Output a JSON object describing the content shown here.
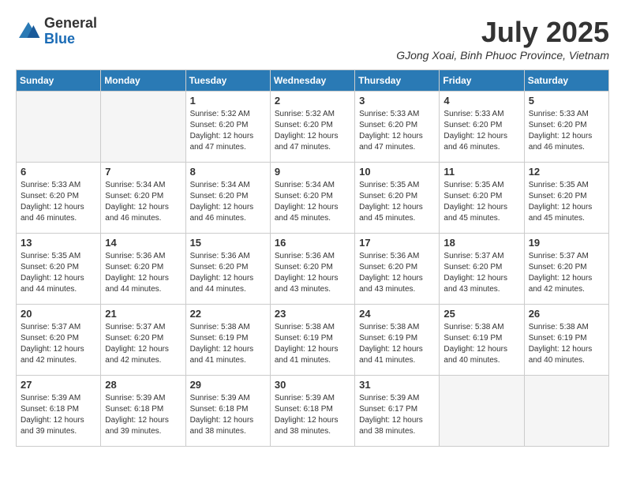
{
  "header": {
    "logo_line1": "General",
    "logo_line2": "Blue",
    "month_title": "July 2025",
    "location": "GJong Xoai, Binh Phuoc Province, Vietnam"
  },
  "days_of_week": [
    "Sunday",
    "Monday",
    "Tuesday",
    "Wednesday",
    "Thursday",
    "Friday",
    "Saturday"
  ],
  "weeks": [
    [
      {
        "day": "",
        "info": ""
      },
      {
        "day": "",
        "info": ""
      },
      {
        "day": "1",
        "info": "Sunrise: 5:32 AM\nSunset: 6:20 PM\nDaylight: 12 hours and 47 minutes."
      },
      {
        "day": "2",
        "info": "Sunrise: 5:32 AM\nSunset: 6:20 PM\nDaylight: 12 hours and 47 minutes."
      },
      {
        "day": "3",
        "info": "Sunrise: 5:33 AM\nSunset: 6:20 PM\nDaylight: 12 hours and 47 minutes."
      },
      {
        "day": "4",
        "info": "Sunrise: 5:33 AM\nSunset: 6:20 PM\nDaylight: 12 hours and 46 minutes."
      },
      {
        "day": "5",
        "info": "Sunrise: 5:33 AM\nSunset: 6:20 PM\nDaylight: 12 hours and 46 minutes."
      }
    ],
    [
      {
        "day": "6",
        "info": "Sunrise: 5:33 AM\nSunset: 6:20 PM\nDaylight: 12 hours and 46 minutes."
      },
      {
        "day": "7",
        "info": "Sunrise: 5:34 AM\nSunset: 6:20 PM\nDaylight: 12 hours and 46 minutes."
      },
      {
        "day": "8",
        "info": "Sunrise: 5:34 AM\nSunset: 6:20 PM\nDaylight: 12 hours and 46 minutes."
      },
      {
        "day": "9",
        "info": "Sunrise: 5:34 AM\nSunset: 6:20 PM\nDaylight: 12 hours and 45 minutes."
      },
      {
        "day": "10",
        "info": "Sunrise: 5:35 AM\nSunset: 6:20 PM\nDaylight: 12 hours and 45 minutes."
      },
      {
        "day": "11",
        "info": "Sunrise: 5:35 AM\nSunset: 6:20 PM\nDaylight: 12 hours and 45 minutes."
      },
      {
        "day": "12",
        "info": "Sunrise: 5:35 AM\nSunset: 6:20 PM\nDaylight: 12 hours and 45 minutes."
      }
    ],
    [
      {
        "day": "13",
        "info": "Sunrise: 5:35 AM\nSunset: 6:20 PM\nDaylight: 12 hours and 44 minutes."
      },
      {
        "day": "14",
        "info": "Sunrise: 5:36 AM\nSunset: 6:20 PM\nDaylight: 12 hours and 44 minutes."
      },
      {
        "day": "15",
        "info": "Sunrise: 5:36 AM\nSunset: 6:20 PM\nDaylight: 12 hours and 44 minutes."
      },
      {
        "day": "16",
        "info": "Sunrise: 5:36 AM\nSunset: 6:20 PM\nDaylight: 12 hours and 43 minutes."
      },
      {
        "day": "17",
        "info": "Sunrise: 5:36 AM\nSunset: 6:20 PM\nDaylight: 12 hours and 43 minutes."
      },
      {
        "day": "18",
        "info": "Sunrise: 5:37 AM\nSunset: 6:20 PM\nDaylight: 12 hours and 43 minutes."
      },
      {
        "day": "19",
        "info": "Sunrise: 5:37 AM\nSunset: 6:20 PM\nDaylight: 12 hours and 42 minutes."
      }
    ],
    [
      {
        "day": "20",
        "info": "Sunrise: 5:37 AM\nSunset: 6:20 PM\nDaylight: 12 hours and 42 minutes."
      },
      {
        "day": "21",
        "info": "Sunrise: 5:37 AM\nSunset: 6:20 PM\nDaylight: 12 hours and 42 minutes."
      },
      {
        "day": "22",
        "info": "Sunrise: 5:38 AM\nSunset: 6:19 PM\nDaylight: 12 hours and 41 minutes."
      },
      {
        "day": "23",
        "info": "Sunrise: 5:38 AM\nSunset: 6:19 PM\nDaylight: 12 hours and 41 minutes."
      },
      {
        "day": "24",
        "info": "Sunrise: 5:38 AM\nSunset: 6:19 PM\nDaylight: 12 hours and 41 minutes."
      },
      {
        "day": "25",
        "info": "Sunrise: 5:38 AM\nSunset: 6:19 PM\nDaylight: 12 hours and 40 minutes."
      },
      {
        "day": "26",
        "info": "Sunrise: 5:38 AM\nSunset: 6:19 PM\nDaylight: 12 hours and 40 minutes."
      }
    ],
    [
      {
        "day": "27",
        "info": "Sunrise: 5:39 AM\nSunset: 6:18 PM\nDaylight: 12 hours and 39 minutes."
      },
      {
        "day": "28",
        "info": "Sunrise: 5:39 AM\nSunset: 6:18 PM\nDaylight: 12 hours and 39 minutes."
      },
      {
        "day": "29",
        "info": "Sunrise: 5:39 AM\nSunset: 6:18 PM\nDaylight: 12 hours and 38 minutes."
      },
      {
        "day": "30",
        "info": "Sunrise: 5:39 AM\nSunset: 6:18 PM\nDaylight: 12 hours and 38 minutes."
      },
      {
        "day": "31",
        "info": "Sunrise: 5:39 AM\nSunset: 6:17 PM\nDaylight: 12 hours and 38 minutes."
      },
      {
        "day": "",
        "info": ""
      },
      {
        "day": "",
        "info": ""
      }
    ]
  ]
}
